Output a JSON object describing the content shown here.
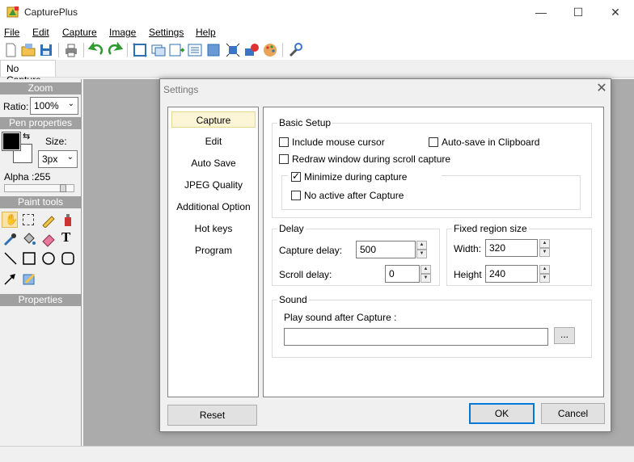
{
  "window": {
    "title": "CapturePlus",
    "minimize": "—",
    "maximize": "☐",
    "close": "✕"
  },
  "menu": [
    "File",
    "Edit",
    "Capture",
    "Image",
    "Settings",
    "Help"
  ],
  "tabs": {
    "active": "No Capture"
  },
  "left_panel": {
    "zoom_header": "Zoom",
    "ratio_label": "Ratio:",
    "ratio_value": "100%",
    "pen_header": "Pen properties",
    "size_label": "Size:",
    "size_value": "3px",
    "alpha_label": "Alpha :255",
    "alpha_level": 1.0,
    "paint_header": "Paint tools",
    "properties_header": "Properties"
  },
  "dialog": {
    "title": "Settings",
    "close_glyph": "✕",
    "nav": [
      "Capture",
      "Edit",
      "Auto Save",
      "JPEG Quality",
      "Additional Option",
      "Hot keys",
      "Program"
    ],
    "selected_nav": "Capture",
    "basic_setup": {
      "label": "Basic Setup",
      "include_cursor": {
        "label": "Include mouse cursor",
        "checked": false
      },
      "autosave_clipboard": {
        "label": "Auto-save in Clipboard",
        "checked": false
      },
      "redraw_window": {
        "label": "Redraw window during scroll capture",
        "checked": false
      },
      "minimize_capture": {
        "label": "Minimize during capture",
        "checked": true
      },
      "no_active": {
        "label": "No active after Capture",
        "checked": false
      }
    },
    "delay": {
      "label": "Delay",
      "capture_delay_label": "Capture delay:",
      "capture_delay_value": "500",
      "scroll_delay_label": "Scroll delay:",
      "scroll_delay_value": "0"
    },
    "fixed_region": {
      "label": "Fixed region size",
      "width_label": "Width:",
      "width_value": "320",
      "height_label": "Height",
      "height_value": "240"
    },
    "sound": {
      "label": "Sound",
      "play_label": "Play sound after Capture :",
      "path_value": "",
      "browse_label": "..."
    },
    "buttons": {
      "reset": "Reset",
      "ok": "OK",
      "cancel": "Cancel"
    }
  },
  "colors": {
    "section_header": "#a0a0a0",
    "workspace": "#ababab",
    "accent": "#0078d7",
    "nav_selected": "#fdf6d6"
  }
}
